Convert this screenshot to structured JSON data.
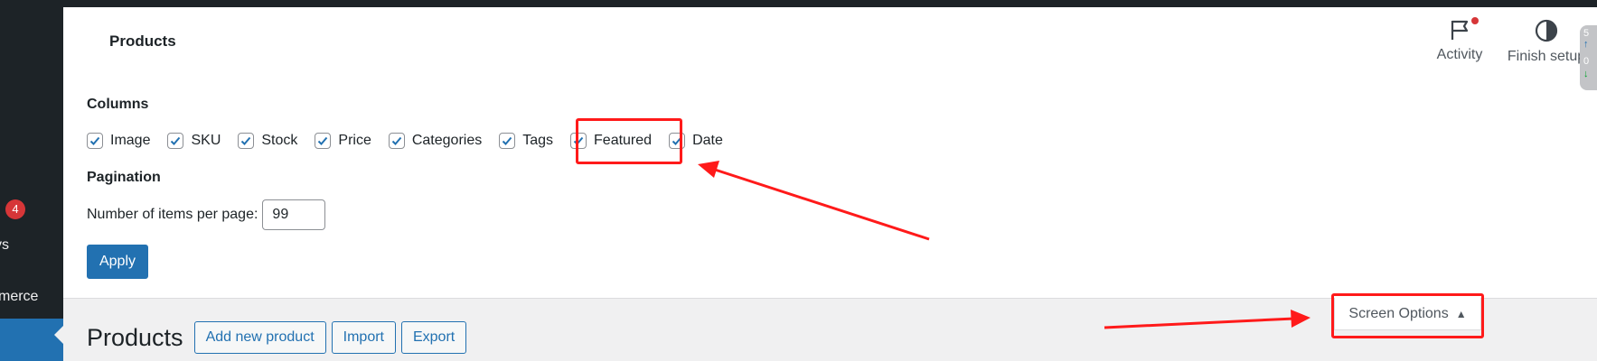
{
  "sidebar": {
    "badge_count": "4",
    "item_partial_1": "ys",
    "item_partial_2": "merce"
  },
  "header": {
    "title": "Products",
    "activity_label": "Activity",
    "finish_setup_label": "Finish setup",
    "side_tab_top": "5",
    "side_tab_bottom": "0"
  },
  "screen_options": {
    "columns_legend": "Columns",
    "columns": [
      {
        "label": "Image",
        "checked": true
      },
      {
        "label": "SKU",
        "checked": true
      },
      {
        "label": "Stock",
        "checked": true
      },
      {
        "label": "Price",
        "checked": true
      },
      {
        "label": "Categories",
        "checked": true
      },
      {
        "label": "Tags",
        "checked": true
      },
      {
        "label": "Featured",
        "checked": true
      },
      {
        "label": "Date",
        "checked": true
      }
    ],
    "pagination_legend": "Pagination",
    "per_page_label": "Number of items per page:",
    "per_page_value": "99",
    "apply_label": "Apply",
    "tab_label": "Screen Options"
  },
  "page": {
    "title": "Products",
    "add_new_label": "Add new product",
    "import_label": "Import",
    "export_label": "Export"
  },
  "colors": {
    "accent": "#2271b1",
    "annotation": "#ff1a1a",
    "admin_dark": "#1d2327",
    "badge": "#d63638"
  }
}
